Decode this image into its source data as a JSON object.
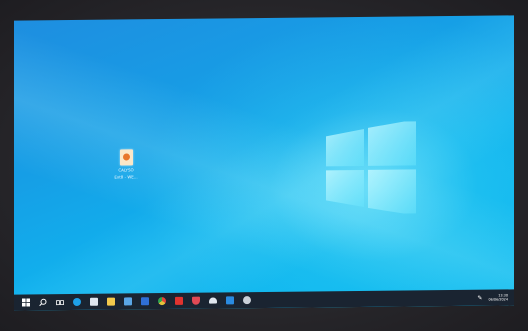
{
  "desktop": {
    "icons": [
      {
        "label_line1": "CALYSO",
        "label_line2": "Ext8 - WE..."
      }
    ]
  },
  "taskbar": {
    "start_icon": "windows-start-icon",
    "search_icon": "search-icon",
    "apps": [
      {
        "name": "task-view-icon",
        "glyph": "⧉",
        "color": "#ffffff"
      },
      {
        "name": "edge-browser-icon",
        "glyph": "",
        "color": "#1ea0e8"
      },
      {
        "name": "mail-icon",
        "glyph": "",
        "color": "#dfe6ee"
      },
      {
        "name": "file-explorer-icon",
        "glyph": "",
        "color": "#f2c94c"
      },
      {
        "name": "store-icon",
        "glyph": "",
        "color": "#5aa6e6"
      },
      {
        "name": "teams-icon",
        "glyph": "",
        "color": "#2f6fd6"
      },
      {
        "name": "chrome-icon",
        "glyph": "",
        "color": "#e2c23a"
      },
      {
        "name": "acrobat-icon",
        "glyph": "",
        "color": "#e0332f"
      },
      {
        "name": "shield-icon",
        "glyph": "",
        "color": "#e04a55"
      },
      {
        "name": "cloud-icon",
        "glyph": "",
        "color": "#dfe6ee"
      },
      {
        "name": "app-icon",
        "glyph": "",
        "color": "#2a8be0"
      },
      {
        "name": "settings-icon",
        "glyph": "",
        "color": "#c9d0d8"
      }
    ],
    "clock": {
      "time": "13:30",
      "date": "06/06/2024"
    }
  }
}
